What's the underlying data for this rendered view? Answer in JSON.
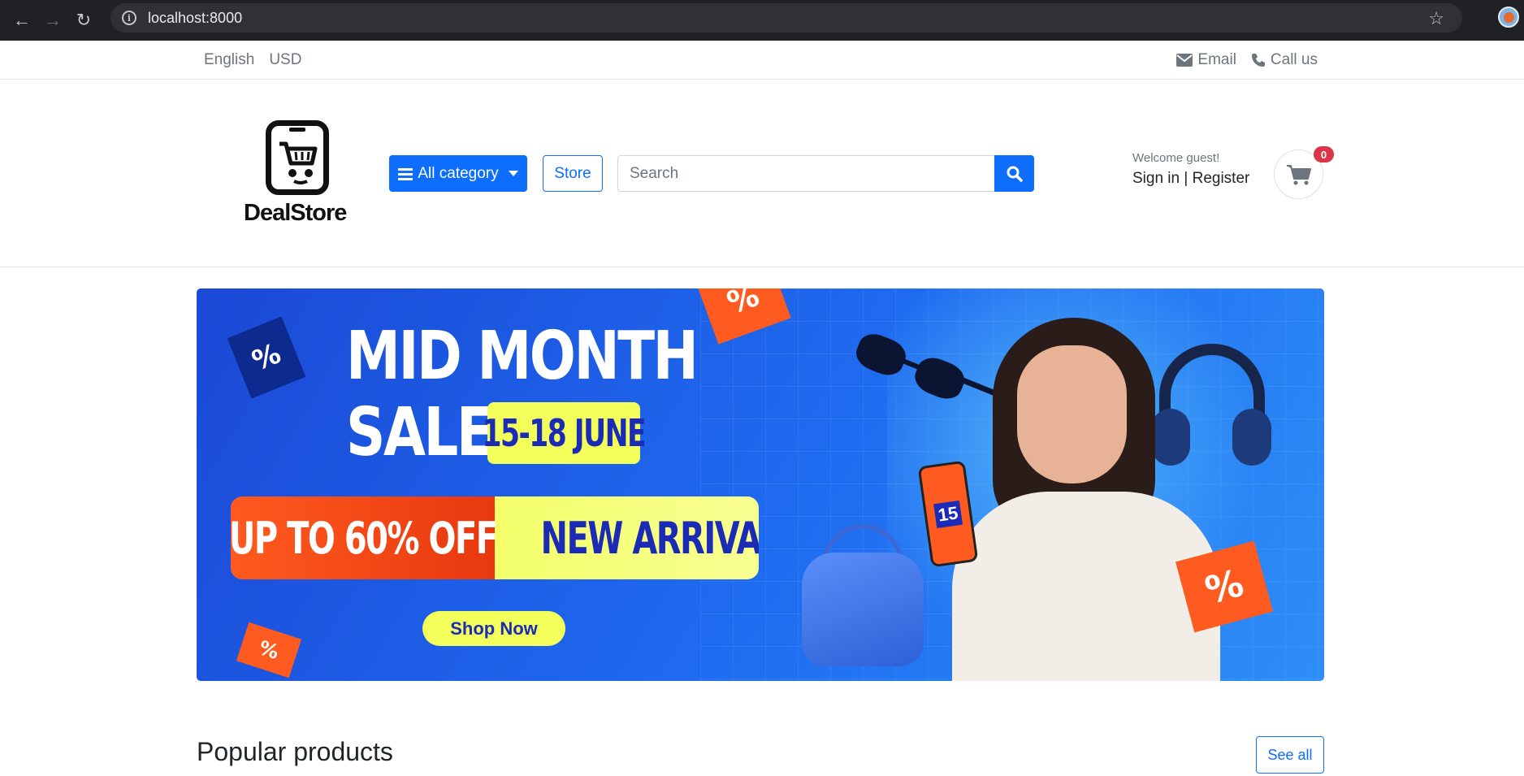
{
  "browser": {
    "url": "localhost:8000"
  },
  "topbar": {
    "language": "English",
    "currency": "USD",
    "email": "Email",
    "call": "Call us"
  },
  "header": {
    "logo_text": "DealStore",
    "category_button": "All category",
    "store_button": "Store",
    "search_placeholder": "Search",
    "welcome": "Welcome guest!",
    "sign_in": "Sign in",
    "separator": "|",
    "register": "Register",
    "cart_count": "0"
  },
  "banner": {
    "line1": "MID MONTH",
    "line2": "SALE",
    "dates": "15-18 JUNE",
    "offer": "UP TO 60% OFF",
    "arrivals": "NEW ARRIVALS",
    "cta": "Shop Now",
    "phone_number": "15",
    "tag_symbol": "%"
  },
  "section": {
    "title": "Popular products",
    "see_all": "See all"
  },
  "colors": {
    "primary": "#0d6efd",
    "badge": "#dc3545",
    "banner_blue": "#1f6cf0",
    "banner_yellow": "#f3ff5a",
    "banner_orange": "#ff5a1f"
  }
}
